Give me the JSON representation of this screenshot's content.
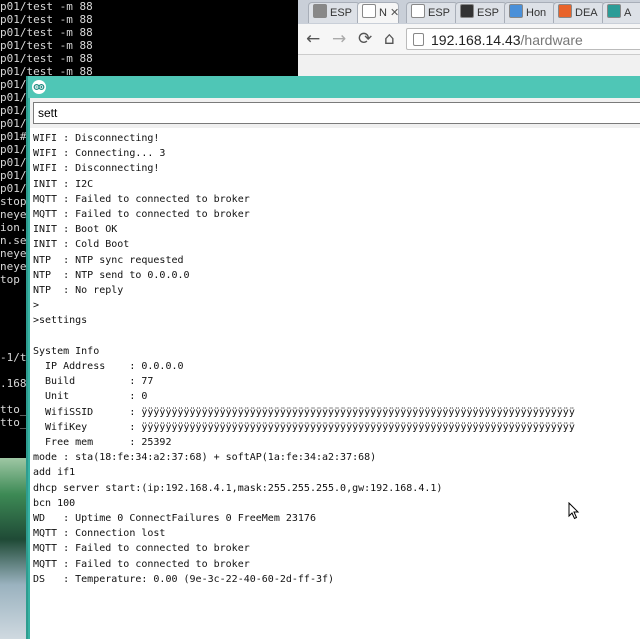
{
  "terminal": {
    "lines": [
      "p01/test -m 88",
      "p01/test -m 88",
      "p01/test -m 88",
      "p01/test -m 88",
      "p01/test -m 88",
      "p01/test -m 88",
      "p01/",
      "p01/",
      "p01/",
      "p01/",
      "p01#",
      "p01/",
      "p01/",
      "p01/",
      "p01/",
      "stop",
      "neye",
      "ion.",
      "n.se",
      "neye",
      "neye",
      "top",
      "",
      "",
      "",
      "",
      "",
      "-1/t",
      "",
      ".168",
      "",
      "tto_",
      "tto_"
    ]
  },
  "browser": {
    "tabs": [
      {
        "label": "ESP",
        "icon": "gear-icon",
        "color": "#888888",
        "active": false
      },
      {
        "label": "N",
        "icon": "page-icon",
        "color": "#ffffff",
        "active": true,
        "close": "✕"
      },
      {
        "label": "ESP",
        "icon": "page-icon",
        "color": "#ffffff",
        "active": false
      },
      {
        "label": "ESP",
        "icon": "github-icon",
        "color": "#333333",
        "active": false
      },
      {
        "label": "Hon",
        "icon": "home-icon",
        "color": "#4a90d9",
        "active": false
      },
      {
        "label": "DEA",
        "icon": "shield-icon",
        "color": "#e8632a",
        "active": false
      },
      {
        "label": "A",
        "icon": "arduino-icon",
        "color": "#2b9c97",
        "active": false
      }
    ],
    "url_host": "192.168.14.43",
    "url_path": "/hardware"
  },
  "serial_monitor": {
    "input_value": "sett",
    "accent": "#4fc6b6",
    "output_lines": [
      "WIFI : Disconnecting!",
      "WIFI : Connecting... 3",
      "WIFI : Disconnecting!",
      "INIT : I2C",
      "MQTT : Failed to connected to broker",
      "MQTT : Failed to connected to broker",
      "INIT : Boot OK",
      "INIT : Cold Boot",
      "NTP  : NTP sync requested",
      "NTP  : NTP send to 0.0.0.0",
      "NTP  : No reply",
      ">",
      ">settings",
      "",
      "System Info",
      "  IP Address    : 0.0.0.0",
      "  Build         : 77",
      "  Unit          : 0",
      "  WifiSSID      : ÿÿÿÿÿÿÿÿÿÿÿÿÿÿÿÿÿÿÿÿÿÿÿÿÿÿÿÿÿÿÿÿÿÿÿÿÿÿÿÿÿÿÿÿÿÿÿÿÿÿÿÿÿÿÿÿÿÿÿÿÿÿÿÿÿÿÿÿÿÿÿÿ",
      "  WifiKey       : ÿÿÿÿÿÿÿÿÿÿÿÿÿÿÿÿÿÿÿÿÿÿÿÿÿÿÿÿÿÿÿÿÿÿÿÿÿÿÿÿÿÿÿÿÿÿÿÿÿÿÿÿÿÿÿÿÿÿÿÿÿÿÿÿÿÿÿÿÿÿÿÿ",
      "  Free mem      : 25392",
      "mode : sta(18:fe:34:a2:37:68) + softAP(1a:fe:34:a2:37:68)",
      "add if1",
      "dhcp server start:(ip:192.168.4.1,mask:255.255.255.0,gw:192.168.4.1)",
      "bcn 100",
      "WD   : Uptime 0 ConnectFailures 0 FreeMem 23176",
      "MQTT : Connection lost",
      "MQTT : Failed to connected to broker",
      "MQTT : Failed to connected to broker",
      "DS   : Temperature: 0.00 (9e-3c-22-40-60-2d-ff-3f)"
    ]
  }
}
